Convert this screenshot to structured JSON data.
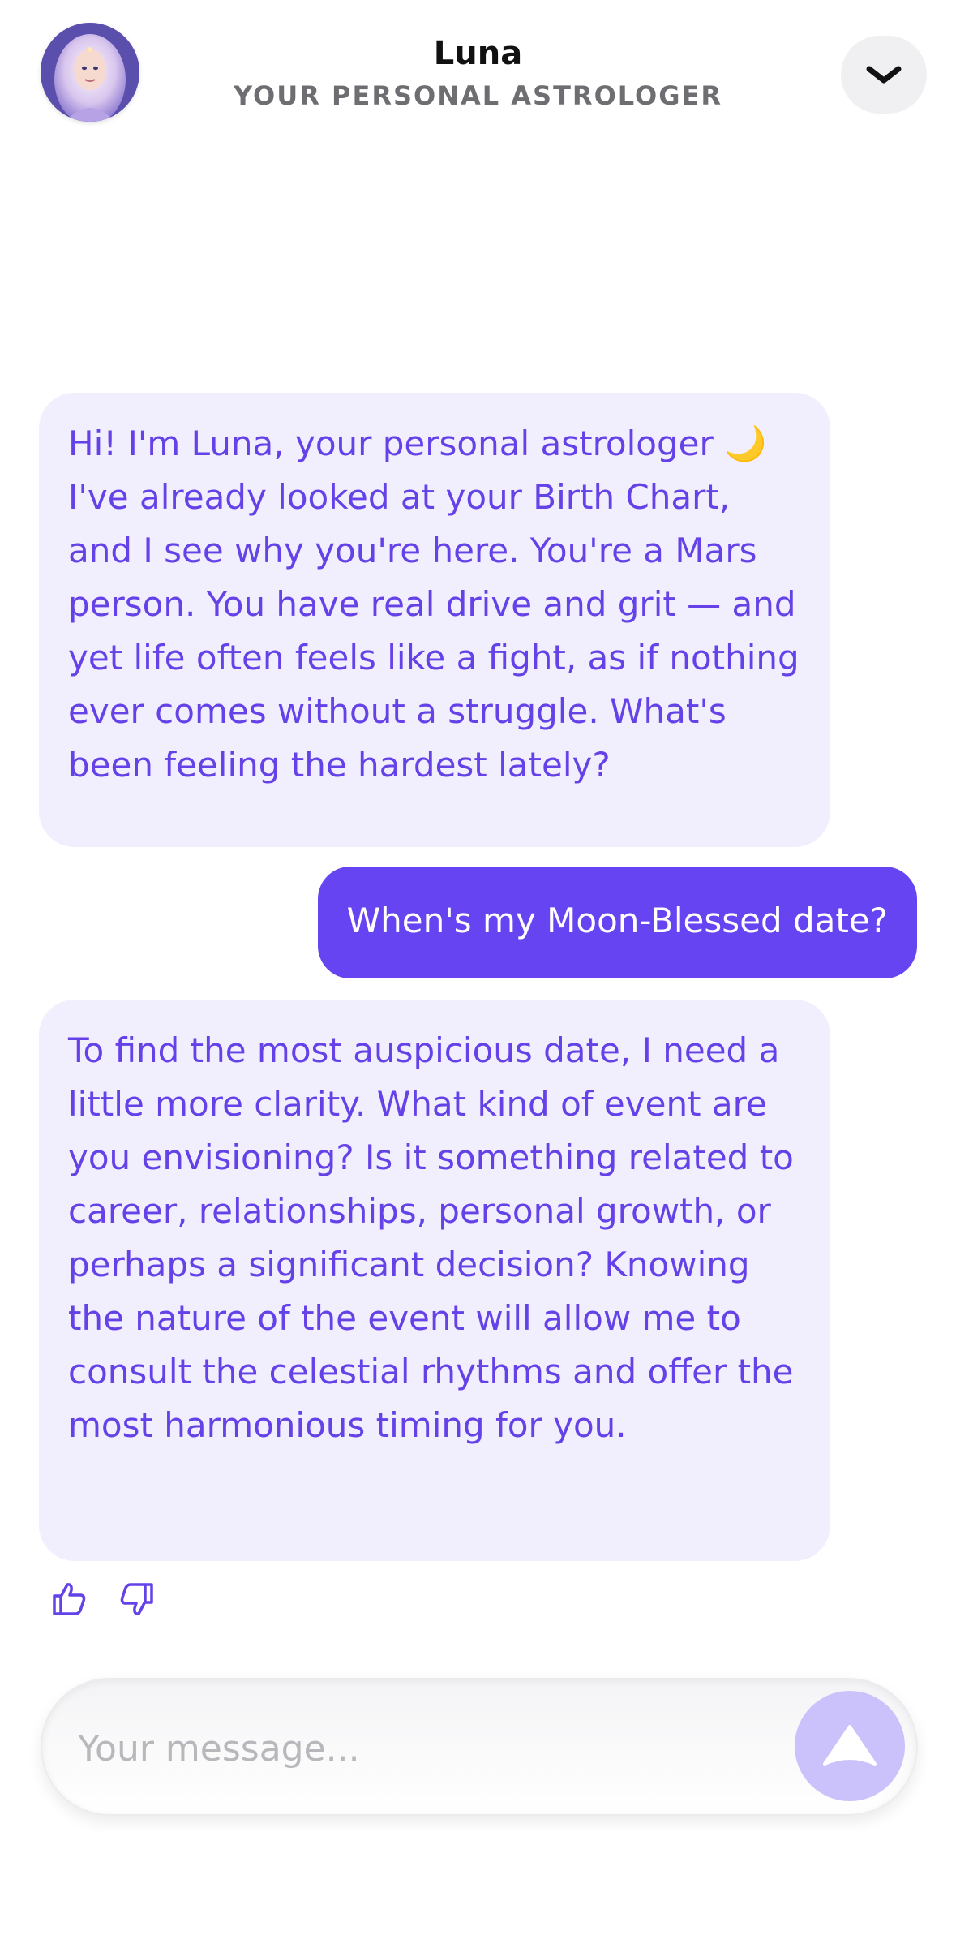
{
  "header": {
    "name": "Luna",
    "subtitle": "YOUR PERSONAL ASTROLOGER",
    "avatar_icon": "astrologer-avatar",
    "collapse_icon": "chevron-down-icon"
  },
  "messages": [
    {
      "role": "assistant",
      "text": "Hi! I'm Luna, your personal astrologer 🌙 I've already looked at your Birth Chart, and I see why you're here. You're a Mars person. You have real drive and grit — and yet life often feels like a fight, as if nothing ever comes without a struggle. What's been feeling the hardest lately?"
    },
    {
      "role": "user",
      "text": "When's my Moon-Blessed date?"
    },
    {
      "role": "assistant",
      "text": "To find the most auspicious date, I need a little more clarity. What kind of event are you envisioning? Is it something related to career, relationships, personal growth, or perhaps a significant decision? Knowing the nature of the event will allow me to consult the celestial rhythms and offer the most harmonious timing for you."
    }
  ],
  "feedback": {
    "like_icon": "thumbs-up-icon",
    "dislike_icon": "thumbs-down-icon"
  },
  "composer": {
    "placeholder": "Your message...",
    "value": "",
    "send_icon": "send-arrow-icon"
  },
  "colors": {
    "accent": "#6644F2",
    "bot_bubble": "#F1EEFD",
    "bot_text": "#6442E8",
    "send_button": "#CBC2FB"
  }
}
